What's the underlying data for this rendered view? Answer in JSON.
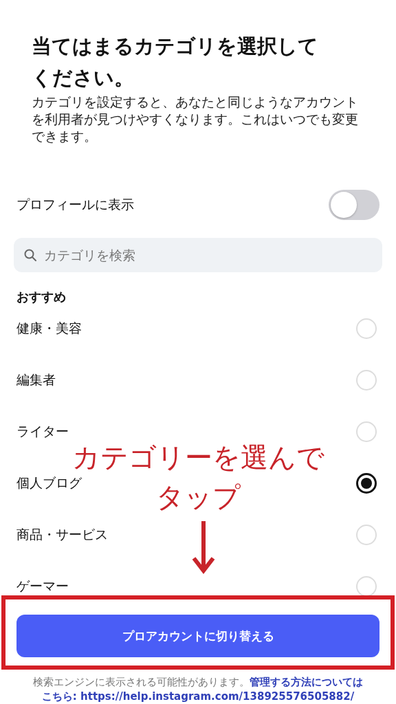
{
  "title": "当てはまるカテゴリを選択してください。",
  "description": "カテゴリを設定すると、あなたと同じようなアカウントを利用者が見つけやすくなります。これはいつでも変更できます。",
  "profile_toggle": {
    "label": "プロフィールに表示",
    "on": false
  },
  "search": {
    "placeholder": "カテゴリを検索"
  },
  "section_heading": "おすすめ",
  "categories": [
    {
      "label": "健康・美容",
      "selected": false
    },
    {
      "label": "編集者",
      "selected": false
    },
    {
      "label": "ライター",
      "selected": false
    },
    {
      "label": "個人ブログ",
      "selected": true
    },
    {
      "label": "商品・サービス",
      "selected": false
    },
    {
      "label": "ゲーマー",
      "selected": false
    }
  ],
  "primary_button": "プロアカウントに切り替える",
  "footer": {
    "text": "検索エンジンに表示される可能性があります。",
    "link_lines": [
      "管理する方法については",
      "こちら: https://help.instagram.com/138925576505882/"
    ]
  },
  "annotation": {
    "lines": [
      "カテゴリーを選んで",
      "タップ"
    ]
  }
}
